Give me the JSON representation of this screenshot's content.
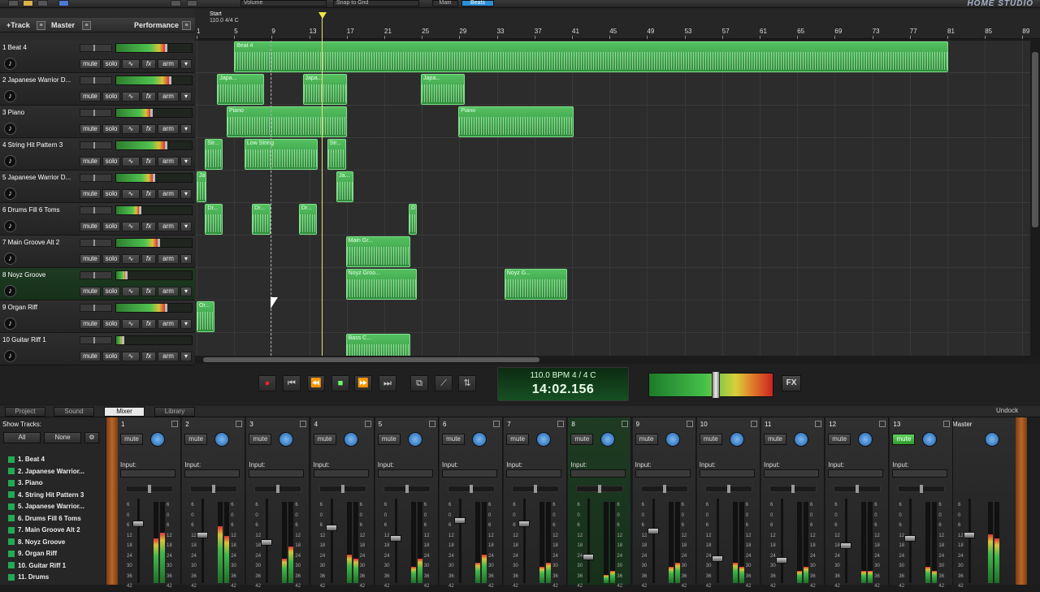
{
  "toolbar": {
    "combo1": "Volume",
    "combo2": "Snap to Grid",
    "btn_a": "Main",
    "btn_b": "Beats",
    "logo": "HOME STUDIO"
  },
  "track_header": {
    "add_track": "+Track",
    "master": "Master",
    "performance": "Performance"
  },
  "tracks": [
    {
      "name": "1 Beat 4",
      "level": 0.64
    },
    {
      "name": "2 Japanese Warrior D...",
      "level": 0.7
    },
    {
      "name": "3 Piano",
      "level": 0.45
    },
    {
      "name": "4 String Hit Pattern 3",
      "level": 0.64
    },
    {
      "name": "5 Japanese Warrior D...",
      "level": 0.48
    },
    {
      "name": "6 Drums Fill 6 Toms",
      "level": 0.3
    },
    {
      "name": "7 Main Groove Alt 2",
      "level": 0.55
    },
    {
      "name": "8 Noyz Groove",
      "level": 0.12
    },
    {
      "name": "9 Organ Riff",
      "level": 0.64
    },
    {
      "name": "10 Guitar Riff 1",
      "level": 0.08
    }
  ],
  "track_buttons": {
    "mute": "mute",
    "solo": "solo",
    "fx": "fx",
    "arm": "arm"
  },
  "ruler": {
    "start_label": "Start",
    "tempo_label": "110.0 4/4 C",
    "bars": [
      "1",
      "5",
      "9",
      "13",
      "17",
      "21",
      "25",
      "29",
      "33",
      "37",
      "41",
      "45",
      "49",
      "53",
      "57",
      "61",
      "65",
      "69",
      "73",
      "77",
      "81",
      "85",
      "89"
    ]
  },
  "clips": [
    {
      "row": 0,
      "start": 5,
      "end": 81.1,
      "title": "Beat 4"
    },
    {
      "row": 1,
      "start": 3.2,
      "end": 8.2,
      "title": "Japa..."
    },
    {
      "row": 1,
      "start": 12.3,
      "end": 17.0,
      "title": "Japa..."
    },
    {
      "row": 1,
      "start": 24.9,
      "end": 29.6,
      "title": "Japa..."
    },
    {
      "row": 2,
      "start": 4.2,
      "end": 17.0,
      "title": "Piano"
    },
    {
      "row": 2,
      "start": 28.9,
      "end": 41.2,
      "title": "Piano"
    },
    {
      "row": 3,
      "start": 1.9,
      "end": 3.8,
      "title": "Str..."
    },
    {
      "row": 3,
      "start": 6.1,
      "end": 13.9,
      "title": "Low String"
    },
    {
      "row": 3,
      "start": 14.9,
      "end": 16.9,
      "title": "Str..."
    },
    {
      "row": 4,
      "start": 1.0,
      "end": 2.0,
      "title": "Ja..."
    },
    {
      "row": 4,
      "start": 15.9,
      "end": 17.7,
      "title": "Ja..."
    },
    {
      "row": 5,
      "start": 1.9,
      "end": 3.8,
      "title": "Dr..."
    },
    {
      "row": 5,
      "start": 6.9,
      "end": 8.9,
      "title": "Dr..."
    },
    {
      "row": 5,
      "start": 11.9,
      "end": 13.8,
      "title": "Dr..."
    },
    {
      "row": 5,
      "start": 23.6,
      "end": 24.5,
      "title": "D"
    },
    {
      "row": 6,
      "start": 16.9,
      "end": 23.8,
      "title": "Main Gr..."
    },
    {
      "row": 7,
      "start": 16.9,
      "end": 24.5,
      "title": "Noyz Groo..."
    },
    {
      "row": 7,
      "start": 33.8,
      "end": 40.5,
      "title": "Noyz G..."
    },
    {
      "row": 8,
      "start": 1.0,
      "end": 2.9,
      "title": "Or..."
    },
    {
      "row": 9,
      "start": 16.9,
      "end": 23.8,
      "title": "Bass C..."
    }
  ],
  "transport": {
    "bpm_line": "110.0 BPM   4 / 4     C",
    "time": "14:02.156",
    "fx": "FX",
    "master_level": 0.54
  },
  "tabs": [
    "Project",
    "Sound",
    "Mixer",
    "Library"
  ],
  "active_tab": "Mixer",
  "undock": "Undock",
  "show_tracks": {
    "title": "Show Tracks:",
    "all": "All",
    "none": "None",
    "items": [
      "1. Beat 4",
      "2. Japanese Warrior...",
      "3. Piano",
      "4. String Hit Pattern 3",
      "5. Japanese Warrior...",
      "6. Drums Fill 6 Toms",
      "7. Main Groove Alt 2",
      "8. Noyz Groove",
      "9. Organ Riff",
      "10. Guitar Riff 1",
      "11. Drums"
    ]
  },
  "mixer": {
    "mute_label": "mute",
    "input_label": "Input:",
    "master_label": "Master",
    "scale": [
      "6",
      "0",
      "6",
      "12",
      "18",
      "24",
      "30",
      "36",
      "42"
    ],
    "channels": [
      {
        "num": "1",
        "fader": 0.3,
        "meter": [
          0.55,
          0.62
        ],
        "selected": false,
        "muted": false
      },
      {
        "num": "2",
        "fader": 0.45,
        "meter": [
          0.7,
          0.58
        ],
        "selected": false,
        "muted": false
      },
      {
        "num": "3",
        "fader": 0.55,
        "meter": [
          0.3,
          0.45
        ],
        "selected": false,
        "muted": false
      },
      {
        "num": "4",
        "fader": 0.35,
        "meter": [
          0.35,
          0.3
        ],
        "selected": false,
        "muted": false
      },
      {
        "num": "5",
        "fader": 0.5,
        "meter": [
          0.2,
          0.3
        ],
        "selected": false,
        "muted": false
      },
      {
        "num": "6",
        "fader": 0.25,
        "meter": [
          0.25,
          0.35
        ],
        "selected": false,
        "muted": false
      },
      {
        "num": "7",
        "fader": 0.3,
        "meter": [
          0.2,
          0.25
        ],
        "selected": false,
        "muted": false
      },
      {
        "num": "8",
        "fader": 0.75,
        "meter": [
          0.1,
          0.15
        ],
        "selected": true,
        "muted": false
      },
      {
        "num": "9",
        "fader": 0.4,
        "meter": [
          0.2,
          0.25
        ],
        "selected": false,
        "muted": false
      },
      {
        "num": "10",
        "fader": 0.78,
        "meter": [
          0.25,
          0.2
        ],
        "selected": false,
        "muted": false
      },
      {
        "num": "11",
        "fader": 0.8,
        "meter": [
          0.15,
          0.2
        ],
        "selected": false,
        "muted": false
      },
      {
        "num": "12",
        "fader": 0.6,
        "meter": [
          0.15,
          0.15
        ],
        "selected": false,
        "muted": false
      },
      {
        "num": "13",
        "fader": 0.5,
        "meter": [
          0.2,
          0.15
        ],
        "selected": false,
        "muted": true
      }
    ],
    "master": {
      "fader": 0.45,
      "meter": [
        0.6,
        0.55
      ]
    }
  }
}
